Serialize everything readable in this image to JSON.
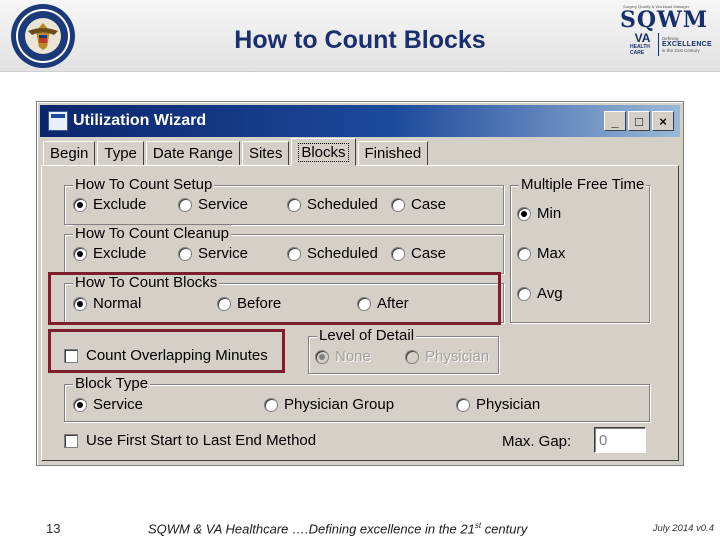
{
  "slide": {
    "title": "How to Count Blocks",
    "seal_text": "FEDERAL HEALTH CARE CENTER",
    "brand": {
      "tagline": "Surgery Quality & Workload Manager",
      "name": "SQWM",
      "va": "VA",
      "va_care": "HEALTH CARE",
      "defining": "Defining",
      "excellence": "EXCELLENCE",
      "century": "in the 21st Century"
    }
  },
  "window": {
    "title": "Utilization Wizard",
    "controls": {
      "minimize": "_",
      "maximize": "□",
      "close": "×"
    },
    "tabs": [
      "Begin",
      "Type",
      "Date Range",
      "Sites",
      "Blocks",
      "Finished"
    ],
    "active_tab": "Blocks"
  },
  "setup": {
    "legend": "How To Count Setup",
    "options": [
      "Exclude",
      "Service",
      "Scheduled",
      "Case"
    ],
    "selected": "Exclude"
  },
  "cleanup": {
    "legend": "How To Count Cleanup",
    "options": [
      "Exclude",
      "Service",
      "Scheduled",
      "Case"
    ],
    "selected": "Exclude"
  },
  "blocks": {
    "legend": "How To Count Blocks",
    "options": [
      "Normal",
      "Before",
      "After"
    ],
    "selected": "Normal"
  },
  "free_time": {
    "legend": "Multiple Free Time",
    "options": [
      "Min",
      "Max",
      "Avg"
    ],
    "selected": "Min"
  },
  "overlap": {
    "label": "Count Overlapping Minutes",
    "checked": false
  },
  "detail": {
    "legend": "Level of Detail",
    "options": [
      "None",
      "Physician"
    ],
    "selected": "None",
    "enabled": false
  },
  "block_type": {
    "legend": "Block Type",
    "options": [
      "Service",
      "Physician Group",
      "Physician"
    ],
    "selected": "Service"
  },
  "first_last": {
    "label": "Use First Start to Last End Method",
    "checked": false
  },
  "max_gap": {
    "label": "Max. Gap:",
    "value": "0"
  },
  "footer": {
    "page": "13",
    "text_pre": "SQWM & VA Healthcare ….Defining excellence in the 21",
    "text_sup": "st",
    "text_post": " century",
    "date": "July 2014 v0.4"
  },
  "colors": {
    "highlight": "#7b1e2d",
    "title_blue": "#1a2f6e",
    "titlebar_dark": "#0b256b",
    "window_face": "#d4d0c8"
  }
}
